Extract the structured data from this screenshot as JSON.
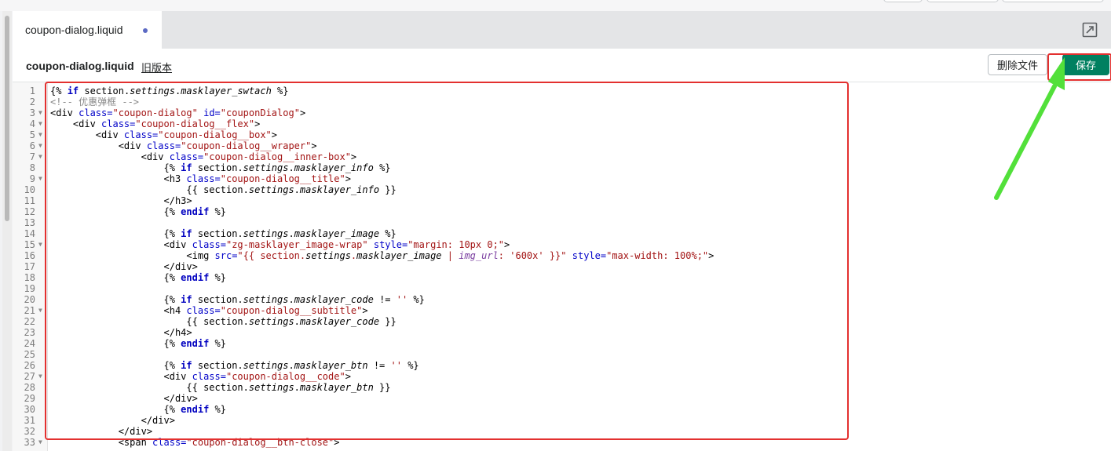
{
  "tab": {
    "label": "coupon-dialog.liquid"
  },
  "header": {
    "file_name": "coupon-dialog.liquid",
    "old_version_link": "旧版本"
  },
  "actions": {
    "delete_label": "删除文件",
    "save_label": "保存"
  },
  "colors": {
    "save": "#008060",
    "highlight": "#e3302f",
    "arrow": "#52e03a"
  },
  "icons": {
    "fullscreen": "fullscreen-icon"
  },
  "code_lines": [
    [
      [
        "{% ",
        "t"
      ],
      [
        "if",
        "kw"
      ],
      [
        " section.",
        "t"
      ],
      [
        "settings",
        "it"
      ],
      [
        ".",
        "t"
      ],
      [
        "masklayer_swtach",
        "it"
      ],
      [
        " %}",
        "t"
      ]
    ],
    [
      [
        "<!-- 优惠弹框 -->",
        "cm"
      ]
    ],
    [
      [
        "<div ",
        "tag"
      ],
      [
        "class=",
        "attr"
      ],
      [
        "\"coupon-dialog\"",
        "str"
      ],
      [
        " ",
        "t"
      ],
      [
        "id=",
        "attr"
      ],
      [
        "\"couponDialog\"",
        "str"
      ],
      [
        ">",
        "tag"
      ]
    ],
    [
      [
        "    <div ",
        "tag"
      ],
      [
        "class=",
        "attr"
      ],
      [
        "\"coupon-dialog__flex\"",
        "str"
      ],
      [
        ">",
        "tag"
      ]
    ],
    [
      [
        "        <div ",
        "tag"
      ],
      [
        "class=",
        "attr"
      ],
      [
        "\"coupon-dialog__box\"",
        "str"
      ],
      [
        ">",
        "tag"
      ]
    ],
    [
      [
        "            <div ",
        "tag"
      ],
      [
        "class=",
        "attr"
      ],
      [
        "\"coupon-dialog__wraper\"",
        "str"
      ],
      [
        ">",
        "tag"
      ]
    ],
    [
      [
        "                <div ",
        "tag"
      ],
      [
        "class=",
        "attr"
      ],
      [
        "\"coupon-dialog__inner-box\"",
        "str"
      ],
      [
        ">",
        "tag"
      ]
    ],
    [
      [
        "                    {% ",
        "t"
      ],
      [
        "if",
        "kw"
      ],
      [
        " section.",
        "t"
      ],
      [
        "settings",
        "it"
      ],
      [
        ".",
        "t"
      ],
      [
        "masklayer_info",
        "it"
      ],
      [
        " %}",
        "t"
      ]
    ],
    [
      [
        "                    <h3 ",
        "tag"
      ],
      [
        "class=",
        "attr"
      ],
      [
        "\"coupon-dialog__title\"",
        "str"
      ],
      [
        ">",
        "tag"
      ]
    ],
    [
      [
        "                        {{ section.",
        "t"
      ],
      [
        "settings",
        "it"
      ],
      [
        ".",
        "t"
      ],
      [
        "masklayer_info",
        "it"
      ],
      [
        " }}",
        "t"
      ]
    ],
    [
      [
        "                    </h3>",
        "tag"
      ]
    ],
    [
      [
        "                    {% ",
        "t"
      ],
      [
        "endif",
        "kw"
      ],
      [
        " %}",
        "t"
      ]
    ],
    [
      [
        "",
        "t"
      ]
    ],
    [
      [
        "                    {% ",
        "t"
      ],
      [
        "if",
        "kw"
      ],
      [
        " section.",
        "t"
      ],
      [
        "settings",
        "it"
      ],
      [
        ".",
        "t"
      ],
      [
        "masklayer_image",
        "it"
      ],
      [
        " %}",
        "t"
      ]
    ],
    [
      [
        "                    <div ",
        "tag"
      ],
      [
        "class=",
        "attr"
      ],
      [
        "\"zg-masklayer_image-wrap\"",
        "str"
      ],
      [
        " ",
        "t"
      ],
      [
        "style=",
        "attr"
      ],
      [
        "\"margin: 10px 0;\"",
        "str"
      ],
      [
        ">",
        "tag"
      ]
    ],
    [
      [
        "                        <img ",
        "tag"
      ],
      [
        "src=",
        "attr"
      ],
      [
        "\"{{ section.",
        "str"
      ],
      [
        "settings",
        "it"
      ],
      [
        ".",
        "str"
      ],
      [
        "masklayer_image",
        "it"
      ],
      [
        " | ",
        "str"
      ],
      [
        "img_url",
        "fil"
      ],
      [
        ": ",
        "str"
      ],
      [
        "'600x'",
        "str"
      ],
      [
        " }}\"",
        "str"
      ],
      [
        " ",
        "t"
      ],
      [
        "style=",
        "attr"
      ],
      [
        "\"max-width: 100%;\"",
        "str"
      ],
      [
        ">",
        "tag"
      ]
    ],
    [
      [
        "                    </div>",
        "tag"
      ]
    ],
    [
      [
        "                    {% ",
        "t"
      ],
      [
        "endif",
        "kw"
      ],
      [
        " %}",
        "t"
      ]
    ],
    [
      [
        "",
        "t"
      ]
    ],
    [
      [
        "                    {% ",
        "t"
      ],
      [
        "if",
        "kw"
      ],
      [
        " section.",
        "t"
      ],
      [
        "settings",
        "it"
      ],
      [
        ".",
        "t"
      ],
      [
        "masklayer_code",
        "it"
      ],
      [
        " != ",
        "t"
      ],
      [
        "''",
        "str"
      ],
      [
        " %}",
        "t"
      ]
    ],
    [
      [
        "                    <h4 ",
        "tag"
      ],
      [
        "class=",
        "attr"
      ],
      [
        "\"coupon-dialog__subtitle\"",
        "str"
      ],
      [
        ">",
        "tag"
      ]
    ],
    [
      [
        "                        {{ section.",
        "t"
      ],
      [
        "settings",
        "it"
      ],
      [
        ".",
        "t"
      ],
      [
        "masklayer_code",
        "it"
      ],
      [
        " }}",
        "t"
      ]
    ],
    [
      [
        "                    </h4>",
        "tag"
      ]
    ],
    [
      [
        "                    {% ",
        "t"
      ],
      [
        "endif",
        "kw"
      ],
      [
        " %}",
        "t"
      ]
    ],
    [
      [
        "",
        "t"
      ]
    ],
    [
      [
        "                    {% ",
        "t"
      ],
      [
        "if",
        "kw"
      ],
      [
        " section.",
        "t"
      ],
      [
        "settings",
        "it"
      ],
      [
        ".",
        "t"
      ],
      [
        "masklayer_btn",
        "it"
      ],
      [
        " != ",
        "t"
      ],
      [
        "''",
        "str"
      ],
      [
        " %}",
        "t"
      ]
    ],
    [
      [
        "                    <div ",
        "tag"
      ],
      [
        "class=",
        "attr"
      ],
      [
        "\"coupon-dialog__code\"",
        "str"
      ],
      [
        ">",
        "tag"
      ]
    ],
    [
      [
        "                        {{ section.",
        "t"
      ],
      [
        "settings",
        "it"
      ],
      [
        ".",
        "t"
      ],
      [
        "masklayer_btn",
        "it"
      ],
      [
        " }}",
        "t"
      ]
    ],
    [
      [
        "                    </div>",
        "tag"
      ]
    ],
    [
      [
        "                    {% ",
        "t"
      ],
      [
        "endif",
        "kw"
      ],
      [
        " %}",
        "t"
      ]
    ],
    [
      [
        "                </div>",
        "tag"
      ]
    ],
    [
      [
        "            </div>",
        "tag"
      ]
    ],
    [
      [
        "            <span ",
        "tag"
      ],
      [
        "class=",
        "attr"
      ],
      [
        "\"coupon-dialog__btn-close\"",
        "str"
      ],
      [
        ">",
        "tag"
      ]
    ]
  ],
  "fold_lines": [
    3,
    4,
    5,
    6,
    7,
    9,
    15,
    21,
    27,
    33
  ]
}
